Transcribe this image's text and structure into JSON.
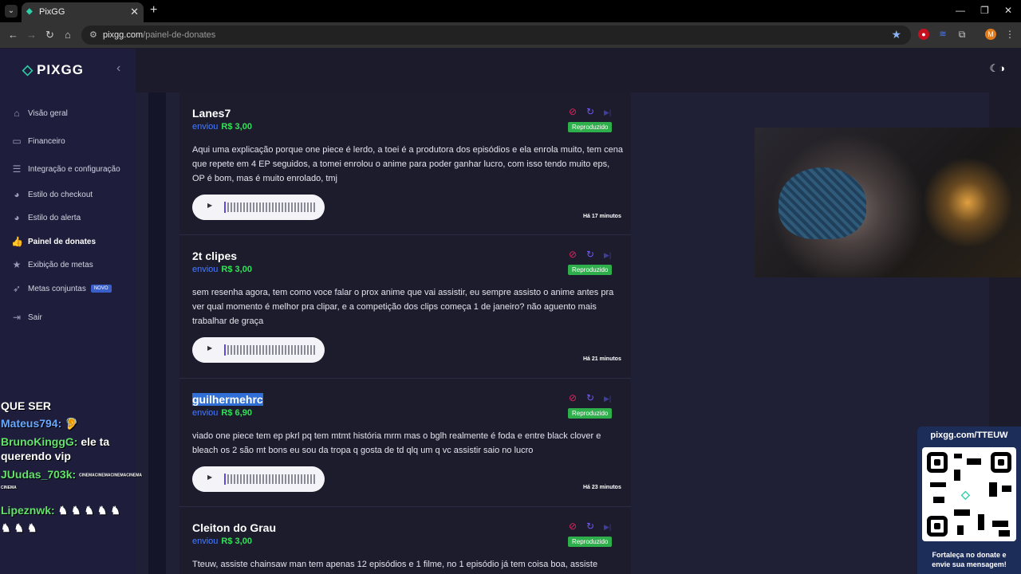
{
  "browser": {
    "tab_title": "PixGG",
    "url_host": "pixgg.com",
    "url_path": "/painel-de-donates",
    "profile_initial": "M"
  },
  "sidebar": {
    "logo_text": "PIXGG",
    "items": [
      {
        "label": "Visão geral",
        "icon": "home-icon"
      },
      {
        "label": "Financeiro",
        "icon": "wallet-icon"
      },
      {
        "label": "Integração e configuração",
        "icon": "settings-icon"
      },
      {
        "label": "Estilo do checkout",
        "icon": "palette-icon"
      },
      {
        "label": "Estilo do alerta",
        "icon": "palette-icon"
      },
      {
        "label": "Painel de donates",
        "icon": "thumbs-up-icon",
        "active": true
      },
      {
        "label": "Exibição de metas",
        "icon": "star-icon"
      },
      {
        "label": "Metas conjuntas",
        "icon": "rocket-icon",
        "badge": "NOVO"
      },
      {
        "label": "Sair",
        "icon": "logout-icon"
      }
    ]
  },
  "feed": {
    "sent_label": "enviou",
    "cards": [
      {
        "donor": "Lanes7",
        "amount": "R$ 3,00",
        "status": "Reproduzido",
        "message": "Aqui uma explicação porque one piece é lerdo, a toei é a produtora dos episódios e ela enrola muito, tem cena que repete em 4 EP seguidos, a tomei enrolou o anime para poder ganhar lucro, com isso tendo muito eps, OP é bom, mas é muito enrolado, tmj",
        "time_ago": "Há 17 minutos"
      },
      {
        "donor": "2t clipes",
        "amount": "R$ 3,00",
        "status": "Reproduzido",
        "message": "sem resenha agora, tem como voce falar o prox anime que vai assistir, eu sempre assisto o anime antes pra ver qual momento é melhor pra clipar, e a competição dos clips começa 1 de janeiro? não aguento mais trabalhar de graça",
        "time_ago": "Há 21 minutos"
      },
      {
        "donor": "guilhermehrc",
        "amount": "R$ 6,90",
        "status": "Reproduzido",
        "message": "viado one piece tem ep pkrl pq tem mtmt história mrm mas o bglh realmente é foda e entre black clover e bleach os 2 são mt bons eu sou da tropa q gosta de td qlq um q vc assistir saio no lucro",
        "time_ago": "Há 23 minutos"
      },
      {
        "donor": "Cleiton do Grau",
        "amount": "R$ 3,00",
        "status": "Reproduzido",
        "message": "Tteuw, assiste chainsaw man tem apenas 12 episódios e 1 filme, no 1 episódio já tem coisa boa, assiste",
        "time_ago": ""
      }
    ]
  },
  "chat": {
    "lines": [
      {
        "user": "",
        "text": "QUE SER"
      },
      {
        "user": "Mateus794:",
        "text": "🦻"
      },
      {
        "user": "BrunoKinggG:",
        "text": "ele ta"
      },
      {
        "user": "",
        "text": "querendo vip"
      },
      {
        "user": "JUudas_703k:",
        "text": ""
      },
      {
        "user": "Lipeznwk:",
        "text": ""
      }
    ],
    "emote_label": "CINEMA"
  },
  "qr_panel": {
    "url": "pixgg.com/TTEUW",
    "caption_1": "Fortaleça no donate e",
    "caption_2": "envie sua mensagem!"
  }
}
